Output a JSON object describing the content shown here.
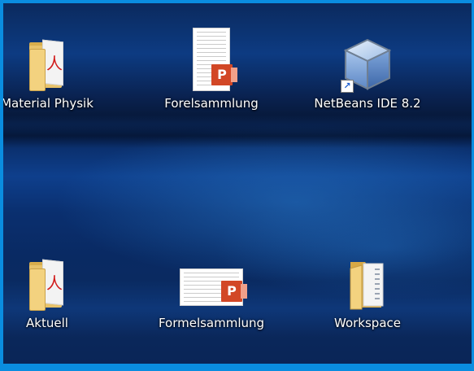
{
  "desktop": {
    "icons": [
      {
        "label": "Material Physik",
        "icon": "pdf-folder-icon"
      },
      {
        "label": "Forelsammlung",
        "icon": "powerpoint-document-icon"
      },
      {
        "label": "NetBeans IDE 8.2",
        "icon": "netbeans-cube-icon"
      },
      {
        "label": "Aktuell",
        "icon": "pdf-folder-icon"
      },
      {
        "label": "Formelsammlung",
        "icon": "powerpoint-document-icon"
      },
      {
        "label": "Workspace",
        "icon": "folder-icon"
      }
    ],
    "ppt_badge_letter": "P",
    "pdf_glyph": "人",
    "shortcut_glyph": "↗"
  },
  "colors": {
    "window_border": "#0a8de0",
    "label_text": "#ffffff",
    "powerpoint": "#d24726"
  }
}
